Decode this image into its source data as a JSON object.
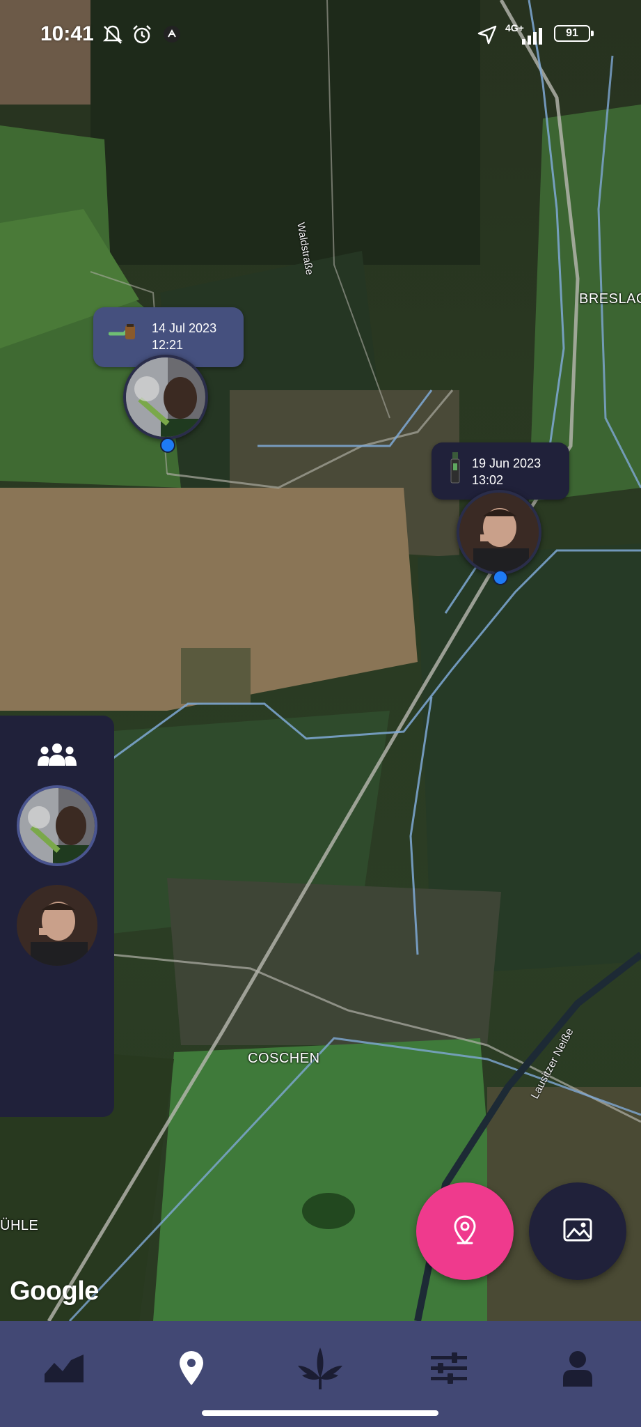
{
  "status_bar": {
    "time": "10:41",
    "network": "4G+",
    "battery": "91",
    "icons": [
      "mute-bell-icon",
      "alarm-icon",
      "app-notification-icon",
      "location-arrow-icon",
      "signal-icon",
      "battery-icon"
    ]
  },
  "map": {
    "labels": {
      "village_top": "BRESLAC",
      "village_bottom": "COSCHEN",
      "village_left": "ÜHLE",
      "road": "Waldstraße",
      "river": "Lausitzer Neiße"
    },
    "attribution": "Google"
  },
  "markers": [
    {
      "date": "14 Jul 2023",
      "time": "12:21",
      "icon": "pipe-icon",
      "avatar": "user-avatar-1"
    },
    {
      "date": "19 Jun 2023",
      "time": "13:02",
      "icon": "vape-pen-icon",
      "avatar": "user-avatar-2"
    }
  ],
  "side_panel": {
    "header_icon": "group-icon",
    "friends": [
      {
        "avatar": "friend-avatar-1"
      },
      {
        "avatar": "friend-avatar-2"
      }
    ]
  },
  "fabs": [
    {
      "icon": "location-pin-icon",
      "color": "#ef3a8d"
    },
    {
      "icon": "image-icon",
      "color": "#20213a"
    }
  ],
  "bottom_nav": [
    {
      "icon": "chart-area-icon"
    },
    {
      "icon": "map-marker-icon"
    },
    {
      "icon": "cannabis-leaf-icon"
    },
    {
      "icon": "sliders-icon"
    },
    {
      "icon": "user-profile-icon"
    }
  ],
  "colors": {
    "nav_bg": "#424874",
    "panel_bg": "#20213a",
    "accent_pink": "#ef3a8d",
    "pin_blue": "#1e7bf5",
    "marker_tag": "#45507e"
  }
}
